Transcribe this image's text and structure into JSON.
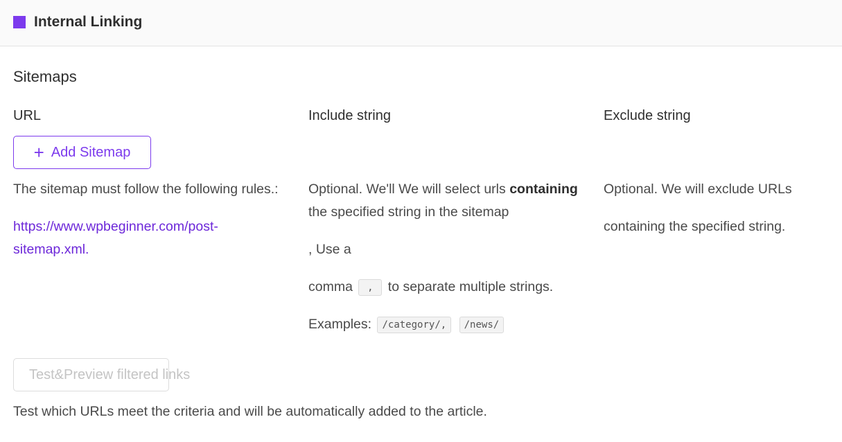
{
  "header": {
    "title": "Internal Linking",
    "accent_color": "#7c3aed"
  },
  "section": {
    "title": "Sitemaps"
  },
  "columns": {
    "url": "URL",
    "include": "Include string",
    "exclude": "Exclude string"
  },
  "url_col": {
    "add_button_icon": "plus-icon",
    "add_button_label": "Add Sitemap",
    "rules_text": "The sitemap must follow the following rules.:",
    "example_link": "https://www.wpbeginner.com/post-sitemap.xml."
  },
  "include_col": {
    "line1_pre": "Optional. We'll We will select urls ",
    "line1_bold": "containing",
    "line1_post": " the specified string in the sitemap",
    "line2": ", Use a",
    "line3_pre": "comma",
    "comma_code": ",",
    "line3_post": "to separate multiple strings.",
    "examples_label": "Examples:",
    "example_1": "/category/,",
    "example_2": "/news/"
  },
  "exclude_col": {
    "line1": "Optional. We will exclude URLs",
    "line2": "containing the specified string."
  },
  "test": {
    "button_label": "Test&Preview filtered links",
    "disabled": true,
    "note": "Test which URLs meet the criteria and will be automatically added to the article."
  }
}
